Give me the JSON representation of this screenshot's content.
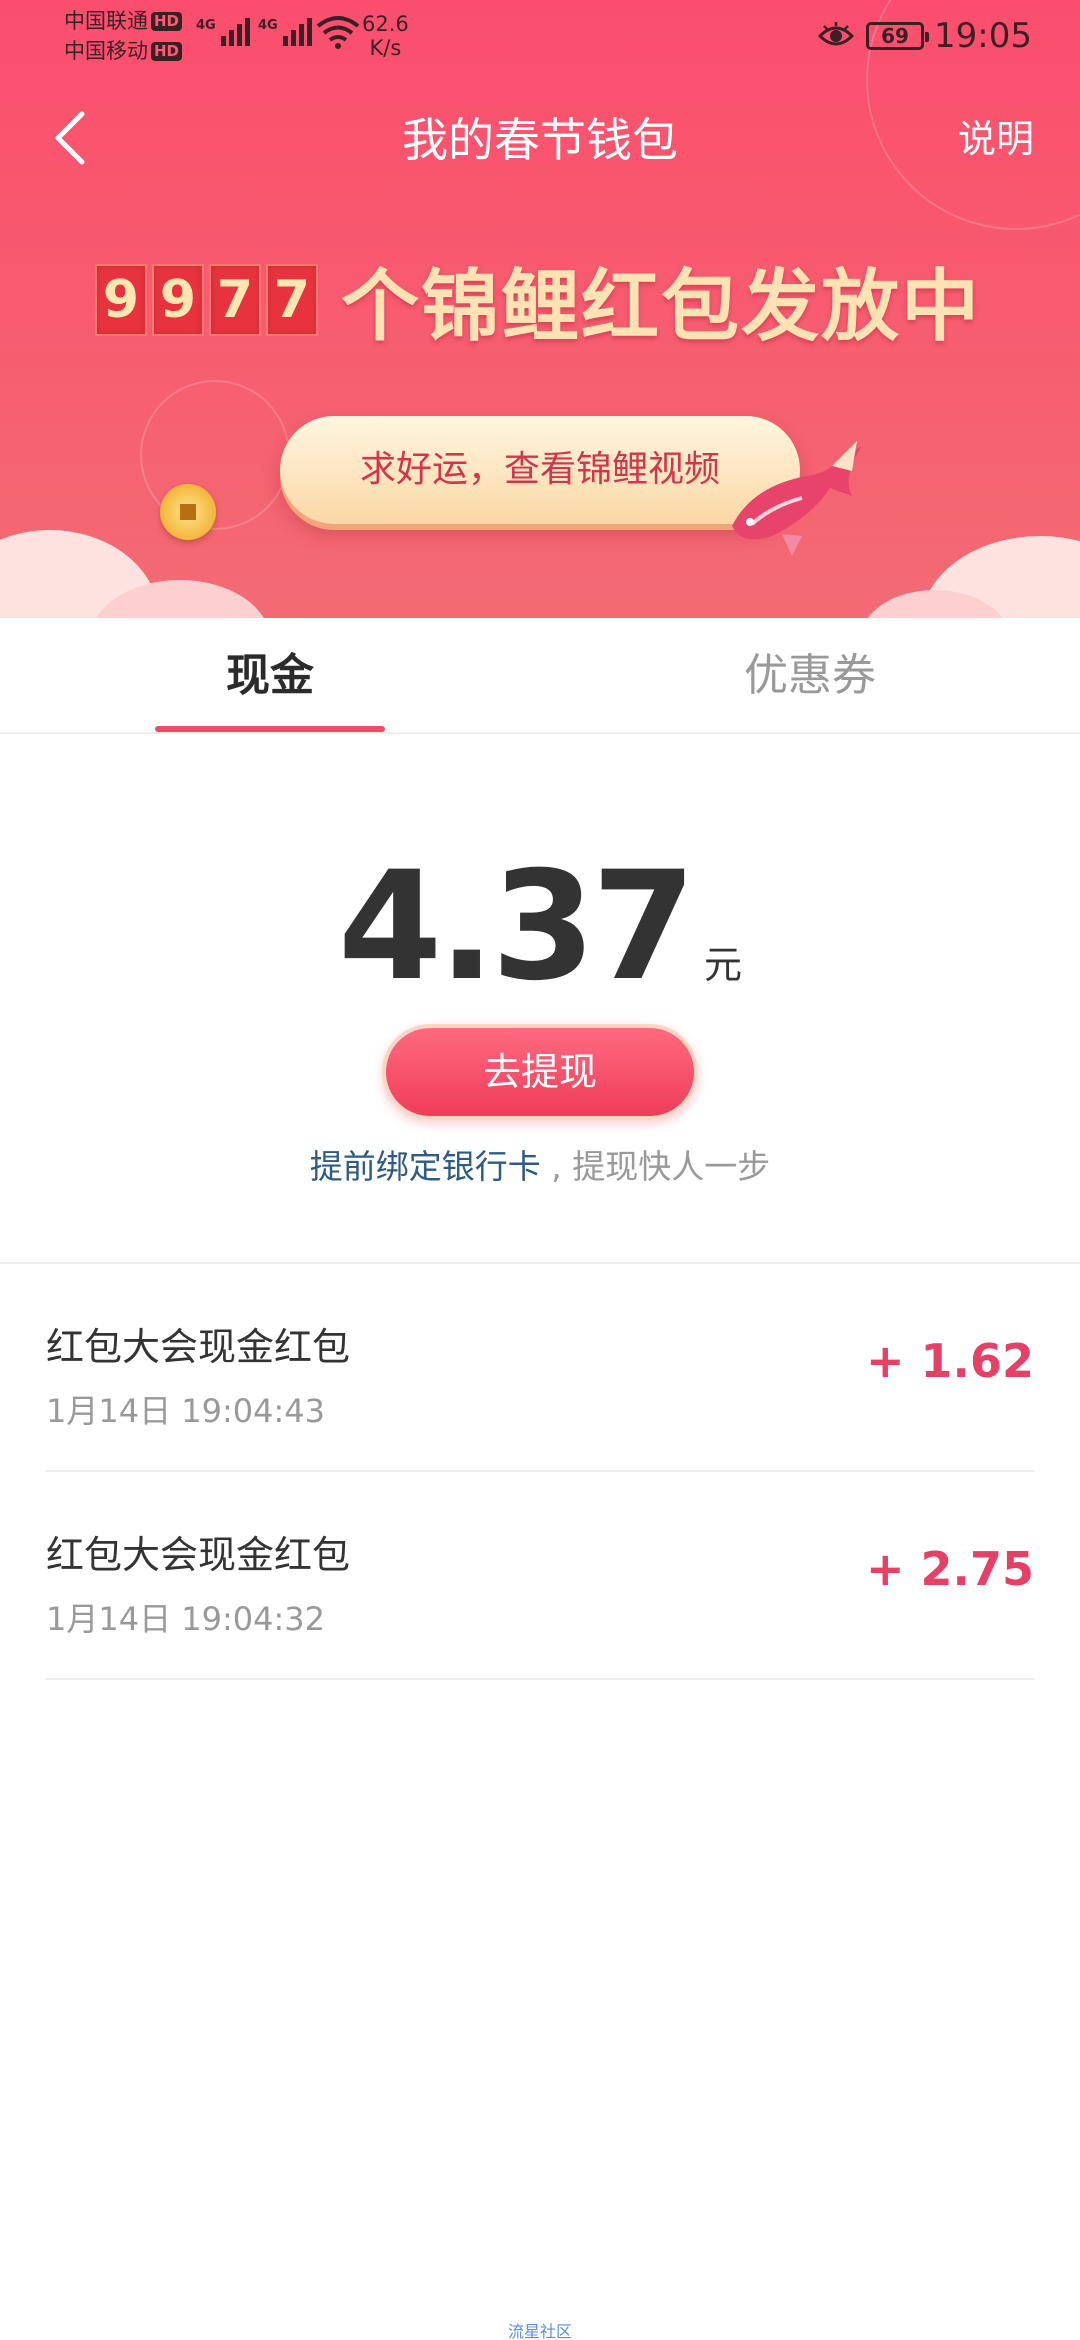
{
  "status_bar": {
    "carrier1": "中国联通",
    "carrier2": "中国移动",
    "hd": "HD",
    "net1": "4G",
    "net2": "4G",
    "speed_value": "62.6",
    "speed_unit": "K/s",
    "battery": "69",
    "time": "19:05"
  },
  "nav": {
    "title": "我的春节钱包",
    "help": "说明"
  },
  "banner": {
    "digits": [
      "9",
      "9",
      "7",
      "7"
    ],
    "counter_text": "个锦鲤红包发放中",
    "pill_label": "求好运，查看锦鲤视频"
  },
  "tabs": {
    "cash": "现金",
    "coupon": "优惠券"
  },
  "balance": {
    "amount": "4.37",
    "unit": "元",
    "withdraw_label": "去提现",
    "bind_link": "提前绑定银行卡",
    "bind_rest": " , 提现快人一步"
  },
  "records": [
    {
      "title": "红包大会现金红包",
      "time": "1月14日 19:04:43",
      "amount": "+ 1.62"
    },
    {
      "title": "红包大会现金红包",
      "time": "1月14日 19:04:32",
      "amount": "+ 2.75"
    }
  ],
  "footer": "流星社区",
  "colors": {
    "brand": "#fb4e6e",
    "amount": "#e54065",
    "link": "#2e5a86"
  }
}
